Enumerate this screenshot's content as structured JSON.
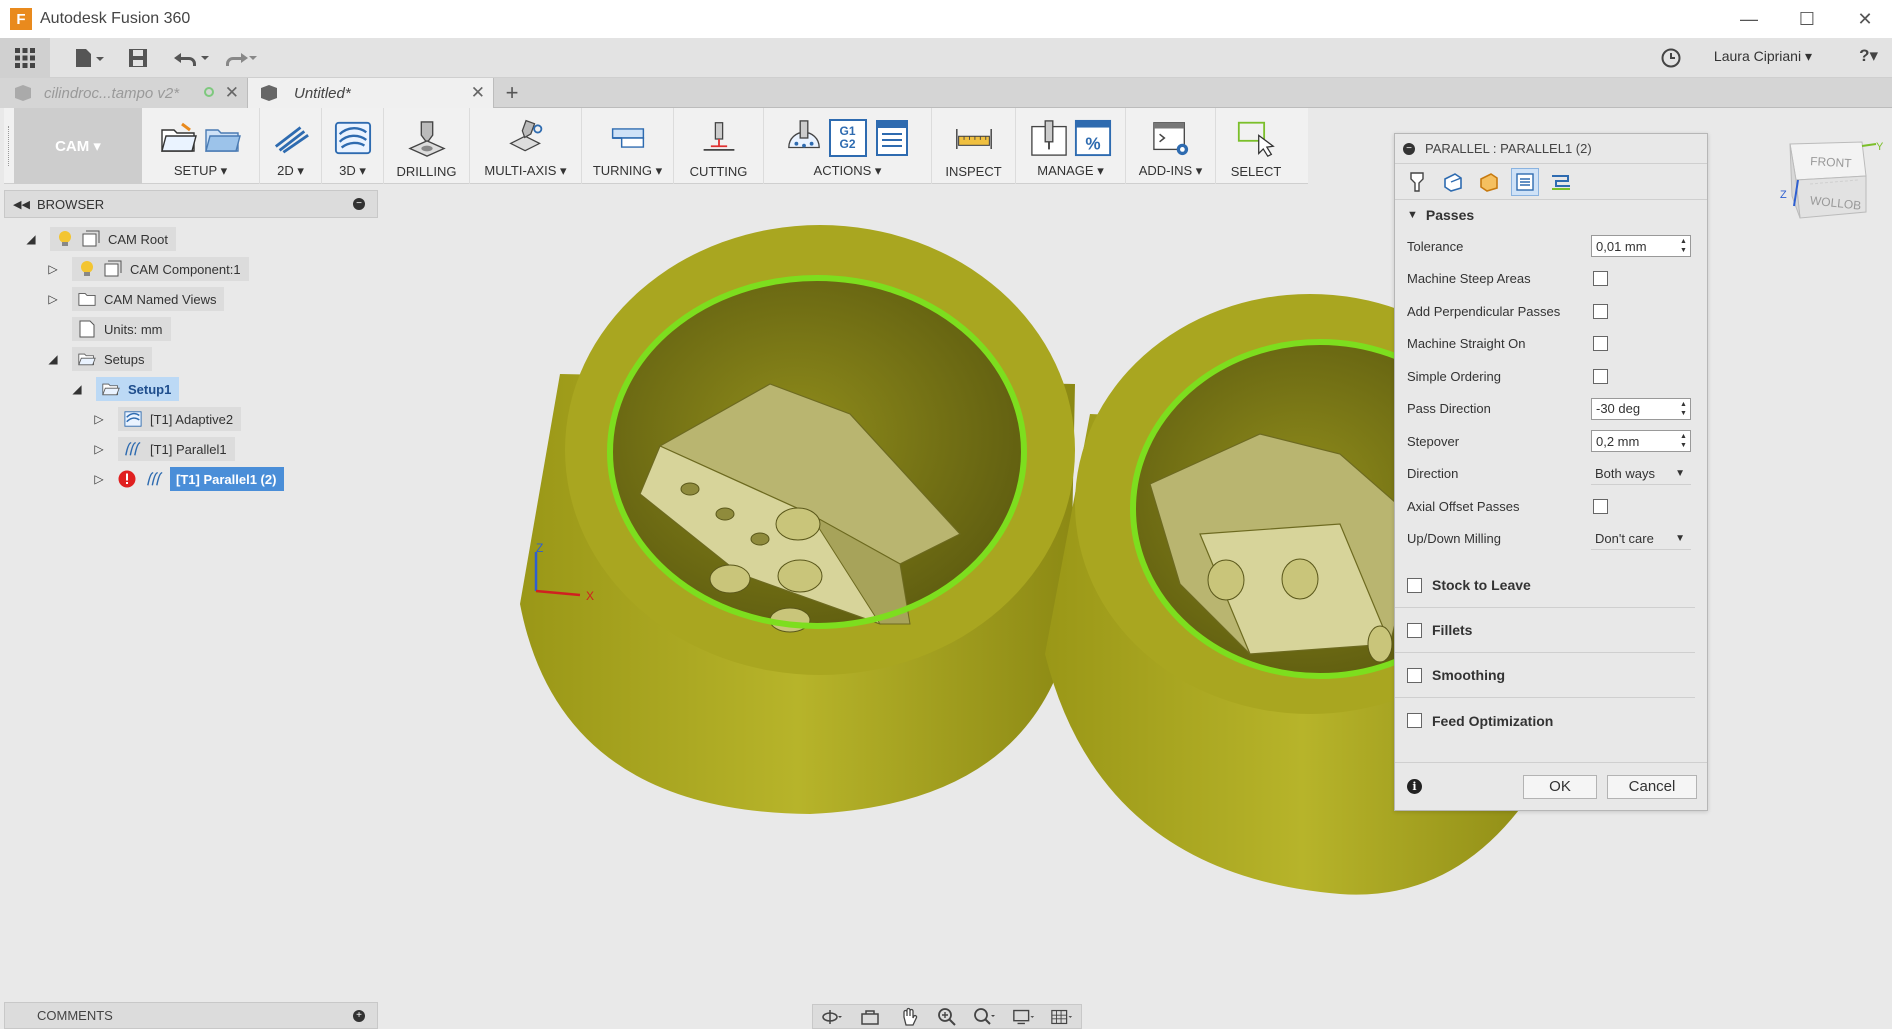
{
  "window": {
    "app_logo": "F",
    "title": "Autodesk Fusion 360",
    "minimize": "—",
    "maximize": "☐",
    "close": "✕"
  },
  "qat": {
    "user": "Laura Cipriani ▾",
    "help": "?▾"
  },
  "tabs": [
    {
      "label": "cilindroc...tampo v2*",
      "status_color": "#7ec97e"
    },
    {
      "label": "Untitled*"
    }
  ],
  "ribbon": {
    "workspace": "CAM ▾",
    "groups": [
      {
        "label": "SETUP ▾"
      },
      {
        "label": "2D ▾"
      },
      {
        "label": "3D ▾"
      },
      {
        "label": "DRILLING"
      },
      {
        "label": "MULTI-AXIS ▾"
      },
      {
        "label": "TURNING ▾"
      },
      {
        "label": "CUTTING"
      },
      {
        "label": "ACTIONS ▾"
      },
      {
        "label": "INSPECT"
      },
      {
        "label": "MANAGE ▾"
      },
      {
        "label": "ADD-INS ▾"
      },
      {
        "label": "SELECT"
      }
    ],
    "g1g2": [
      "G1",
      "G2"
    ]
  },
  "browser": {
    "title": "BROWSER",
    "items": [
      {
        "label": "CAM Root"
      },
      {
        "label": "CAM Component:1"
      },
      {
        "label": "CAM Named Views"
      },
      {
        "label": "Units: mm"
      },
      {
        "label": "Setups"
      },
      {
        "label": "Setup1"
      },
      {
        "label": "[T1] Adaptive2"
      },
      {
        "label": "[T1] Parallel1"
      },
      {
        "label": "[T1] Parallel1 (2)"
      }
    ]
  },
  "viewcube": {
    "front": "FRONT",
    "bottom": "WOLLOB"
  },
  "axes": {
    "z": "Z",
    "x": "X"
  },
  "dialog": {
    "title": "PARALLEL : PARALLEL1 (2)",
    "section": "Passes",
    "rows": [
      {
        "label": "Tolerance",
        "value": "0,01 mm"
      },
      {
        "label": "Machine Steep Areas"
      },
      {
        "label": "Add Perpendicular Passes"
      },
      {
        "label": "Machine Straight On"
      },
      {
        "label": "Simple Ordering"
      },
      {
        "label": "Pass Direction",
        "value": "-30 deg"
      },
      {
        "label": "Stepover",
        "value": "0,2 mm"
      },
      {
        "label": "Direction",
        "value": "Both ways"
      },
      {
        "label": "Axial Offset Passes"
      },
      {
        "label": "Up/Down Milling",
        "value": "Don't care"
      }
    ],
    "groups": [
      {
        "label": "Stock to Leave"
      },
      {
        "label": "Fillets"
      },
      {
        "label": "Smoothing"
      },
      {
        "label": "Feed Optimization"
      }
    ],
    "ok": "OK",
    "cancel": "Cancel"
  },
  "comments": {
    "title": "COMMENTS"
  },
  "colors": {
    "part": "#a8a521",
    "part_dark": "#6e6b16",
    "highlight": "#7dde1e",
    "selection": "#4a8ed8"
  }
}
